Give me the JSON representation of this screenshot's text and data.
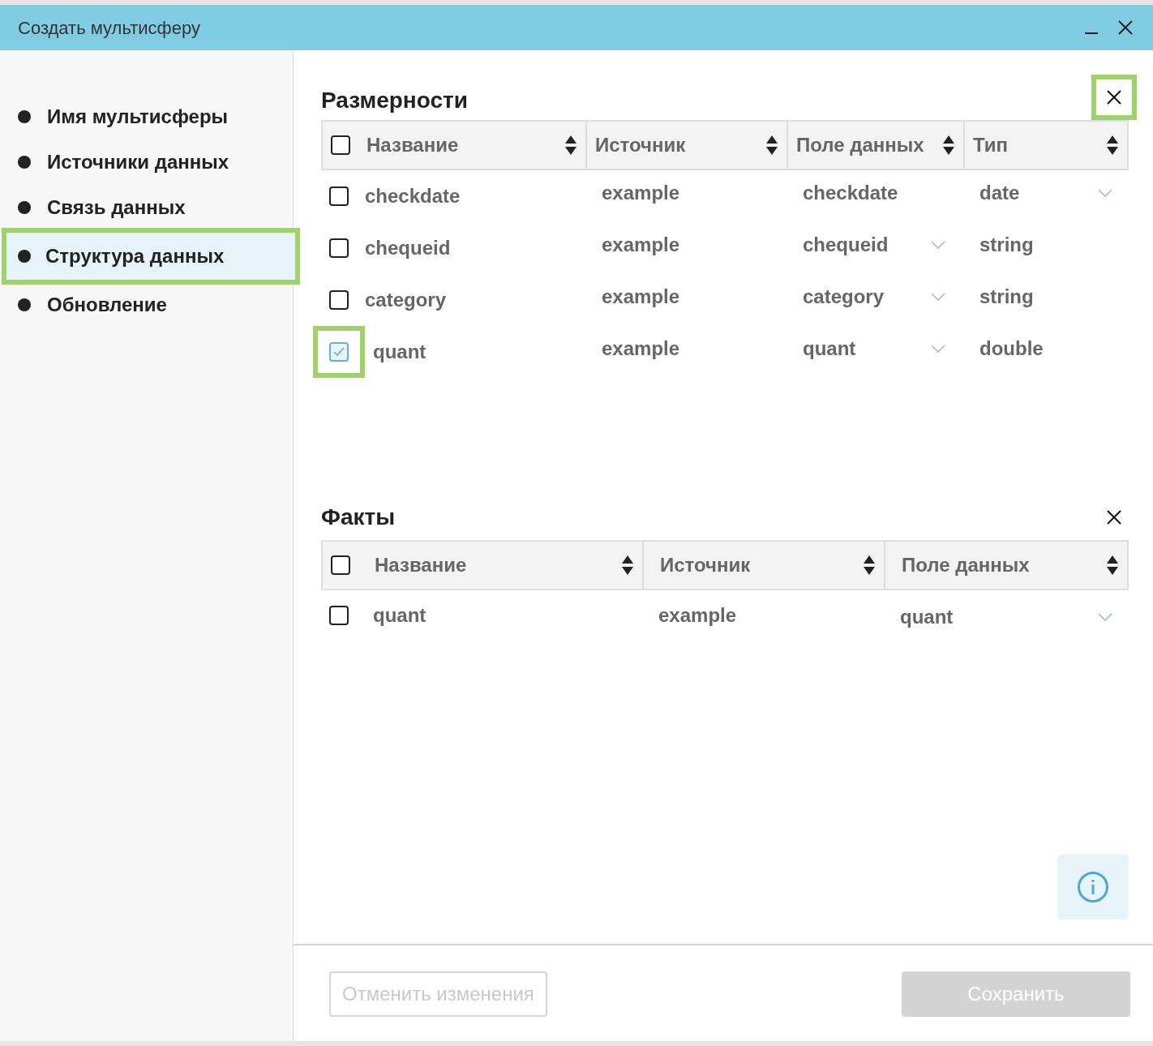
{
  "window": {
    "title": "Создать мультисферу"
  },
  "sidebar": {
    "items": [
      {
        "label": "Имя мультисферы",
        "selected": false
      },
      {
        "label": "Источники данных",
        "selected": false
      },
      {
        "label": "Связь данных",
        "selected": false
      },
      {
        "label": "Структура данных",
        "selected": true
      },
      {
        "label": "Обновление",
        "selected": false
      }
    ]
  },
  "dimensions": {
    "title": "Размерности",
    "close_highlighted": true,
    "select_all_checked": false,
    "columns": [
      "Название",
      "Источник",
      "Поле данных",
      "Тип"
    ],
    "rows": [
      {
        "checked": false,
        "highlighted": false,
        "name": "checkdate",
        "source": "example",
        "field": "checkdate",
        "field_dropdown": false,
        "type": "date",
        "type_dropdown": true
      },
      {
        "checked": false,
        "highlighted": false,
        "name": "chequeid",
        "source": "example",
        "field": "chequeid",
        "field_dropdown": true,
        "type": "string",
        "type_dropdown": false
      },
      {
        "checked": false,
        "highlighted": false,
        "name": "category",
        "source": "example",
        "field": "category",
        "field_dropdown": true,
        "type": "string",
        "type_dropdown": false
      },
      {
        "checked": true,
        "highlighted": true,
        "name": "quant",
        "source": "example",
        "field": "quant",
        "field_dropdown": true,
        "type": "double",
        "type_dropdown": false
      }
    ]
  },
  "facts": {
    "title": "Факты",
    "close_highlighted": false,
    "select_all_checked": false,
    "columns": [
      "Название",
      "Источник",
      "Поле данных"
    ],
    "rows": [
      {
        "checked": false,
        "highlighted": false,
        "name": "quant",
        "source": "example",
        "field": "quant",
        "field_dropdown": true
      }
    ]
  },
  "footer": {
    "cancel": "Отменить изменения",
    "save": "Сохранить"
  }
}
